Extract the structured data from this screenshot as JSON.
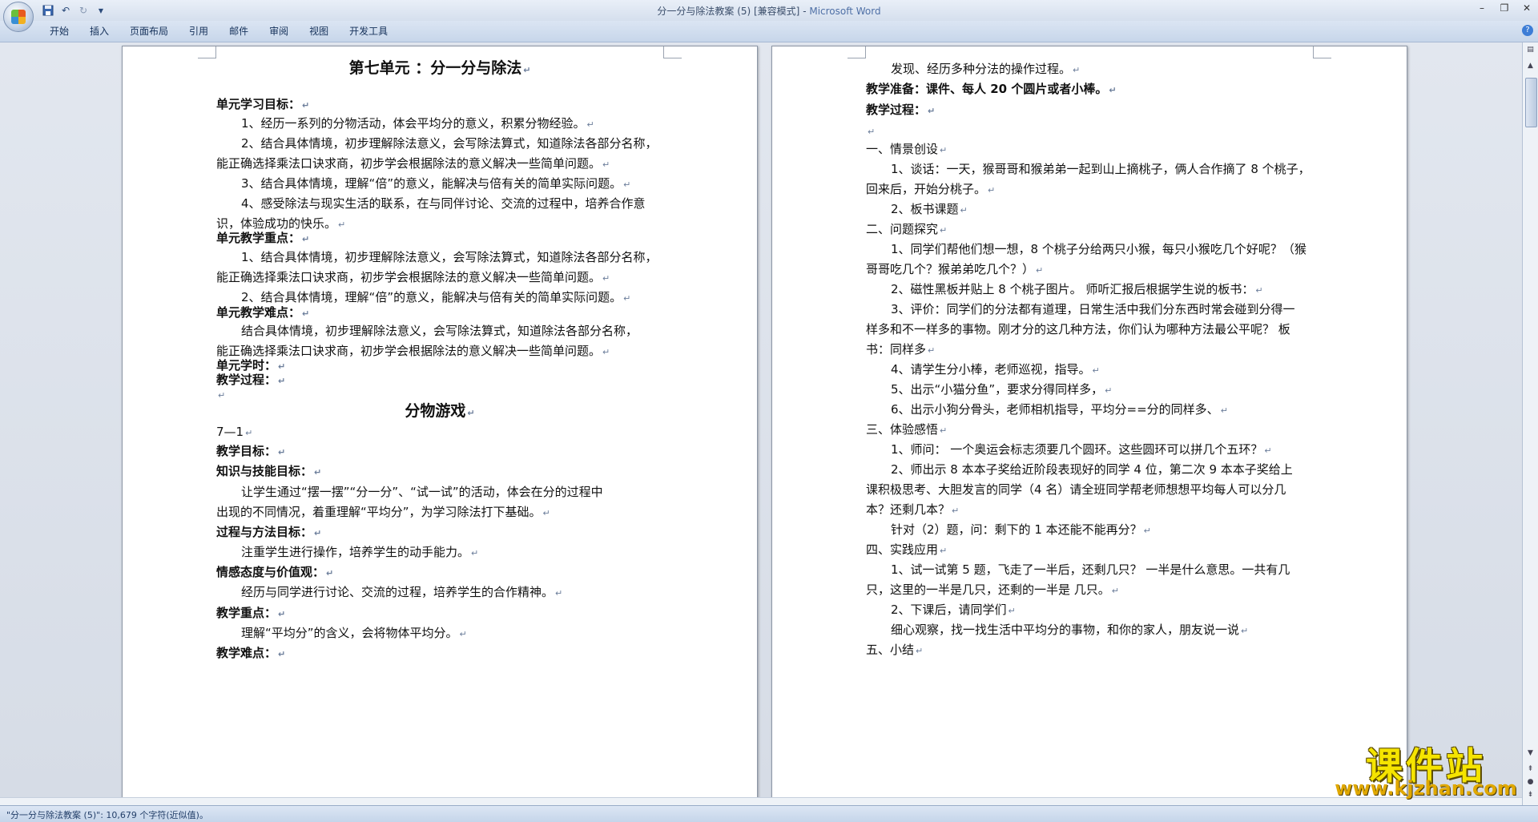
{
  "window": {
    "title_doc": "分一分与除法教案 (5) [兼容模式]",
    "title_sep": " - ",
    "title_app": "Microsoft Word"
  },
  "ribbon": {
    "tabs": [
      "开始",
      "插入",
      "页面布局",
      "引用",
      "邮件",
      "审阅",
      "视图",
      "开发工具"
    ]
  },
  "paragraph_mark": "↵",
  "pages": {
    "left": [
      {
        "text": "第七单元 ：分一分与除法",
        "style": "heading"
      },
      {
        "text": "单元学习目标：",
        "style": "bold"
      },
      {
        "text": "1、经历一系列的分物活动，体会平均分的意义，积累分物经验。",
        "style": "indent"
      },
      {
        "text": "2、结合具体情境，初步理解除法意义，会写除法算式，知道除法各部分名称，",
        "style": "indent",
        "nomark": true
      },
      {
        "text": "能正确选择乘法口诀求商，初步学会根据除法的意义解决一些简单问题。",
        "style": "plain"
      },
      {
        "text": "3、结合具体情境，理解“倍”的意义，能解决与倍有关的简单实际问题。",
        "style": "indent"
      },
      {
        "text": "4、感受除法与现实生活的联系，在与同伴讨论、交流的过程中，培养合作意",
        "style": "indent",
        "nomark": true
      },
      {
        "text": "识，体验成功的快乐。",
        "style": "plain"
      },
      {
        "text": "单元教学重点：",
        "style": "bold"
      },
      {
        "text": "1、结合具体情境，初步理解除法意义，会写除法算式，知道除法各部分名称，",
        "style": "indent",
        "nomark": true
      },
      {
        "text": "能正确选择乘法口诀求商，初步学会根据除法的意义解决一些简单问题。",
        "style": "plain"
      },
      {
        "text": "2、结合具体情境，理解“倍”的意义，能解决与倍有关的简单实际问题。",
        "style": "indent"
      },
      {
        "text": "单元教学难点：",
        "style": "bold"
      },
      {
        "text": "结合具体情境，初步理解除法意义，会写除法算式，知道除法各部分名称，",
        "style": "indent",
        "nomark": true
      },
      {
        "text": "能正确选择乘法口诀求商，初步学会根据除法的意义解决一些简单问题。",
        "style": "plain"
      },
      {
        "text": "单元学时：",
        "style": "bold"
      },
      {
        "text": "教学过程：",
        "style": "bold"
      },
      {
        "text": "",
        "style": "plain"
      },
      {
        "text": "分物游戏",
        "style": "heading"
      },
      {
        "text": "7—1",
        "style": "plain"
      },
      {
        "text": "教学目标：",
        "style": "bold"
      },
      {
        "text": "知识与技能目标：",
        "style": "bold"
      },
      {
        "text": "让学生通过“摆一摆”“分一分”、“试一试”的活动，体会在分的过程中",
        "style": "indent",
        "nomark": true
      },
      {
        "text": "出现的不同情况，着重理解“平均分”，为学习除法打下基础。",
        "style": "plain"
      },
      {
        "text": "过程与方法目标：",
        "style": "bold"
      },
      {
        "text": "注重学生进行操作，培养学生的动手能力。",
        "style": "indent"
      },
      {
        "text": "情感态度与价值观：",
        "style": "bold"
      },
      {
        "text": "经历与同学进行讨论、交流的过程，培养学生的合作精神。",
        "style": "indent"
      },
      {
        "text": "教学重点：",
        "style": "bold"
      },
      {
        "text": "理解“平均分”的含义，会将物体平均分。",
        "style": "indent"
      },
      {
        "text": "教学难点：",
        "style": "bold"
      }
    ],
    "right": [
      {
        "text": "发现、经历多种分法的操作过程。",
        "style": "indent"
      },
      {
        "text": "教学准备：课件、每人 20 个圆片或者小棒。",
        "style": "bold"
      },
      {
        "text": "教学过程：",
        "style": "bold"
      },
      {
        "text": "",
        "style": "plain"
      },
      {
        "text": "一、情景创设",
        "style": "plain"
      },
      {
        "text": "1、谈话：一天，猴哥哥和猴弟弟一起到山上摘桃子，俩人合作摘了 8 个桃子，",
        "style": "indent",
        "nomark": true
      },
      {
        "text": "回来后，开始分桃子。",
        "style": "plain"
      },
      {
        "text": "2、板书课题",
        "style": "indent"
      },
      {
        "text": "二、问题探究",
        "style": "plain"
      },
      {
        "text": "1、同学们帮他们想一想，8 个桃子分给两只小猴，每只小猴吃几个好呢？（猴",
        "style": "indent",
        "nomark": true
      },
      {
        "text": "哥哥吃几个？猴弟弟吃几个？）",
        "style": "plain"
      },
      {
        "text": "2、磁性黑板并贴上 8 个桃子图片。 师听汇报后根据学生说的板书：",
        "style": "indent"
      },
      {
        "text": "3、评价：同学们的分法都有道理，日常生活中我们分东西时常会碰到分得一",
        "style": "indent",
        "nomark": true
      },
      {
        "text": "样多和不一样多的事物。刚才分的这几种方法，你们认为哪种方法最公平呢？ 板",
        "style": "plain",
        "nomark": true
      },
      {
        "text": "书：同样多",
        "style": "plain"
      },
      {
        "text": "4、请学生分小棒，老师巡视，指导。",
        "style": "indent"
      },
      {
        "text": "5、出示“小猫分鱼”，要求分得同样多，",
        "style": "indent"
      },
      {
        "text": "6、出示小狗分骨头，老师相机指导，平均分==分的同样多、",
        "style": "indent"
      },
      {
        "text": "三、体验感悟",
        "style": "plain"
      },
      {
        "text": "1、师问： 一个奥运会标志须要几个圆环。这些圆环可以拼几个五环？",
        "style": "indent"
      },
      {
        "text": "2、师出示 8 本本子奖给近阶段表现好的同学 4 位，第二次 9 本本子奖给上",
        "style": "indent",
        "nomark": true
      },
      {
        "text": "课积极思考、大胆发言的同学（4 名）请全班同学帮老师想想平均每人可以分几",
        "style": "plain",
        "nomark": true
      },
      {
        "text": "本？还剩几本？",
        "style": "plain"
      },
      {
        "text": "针对（2）题，问：剩下的 1 本还能不能再分？",
        "style": "indent"
      },
      {
        "text": "四、实践应用",
        "style": "plain"
      },
      {
        "text": "1、试一试第 5 题，飞走了一半后，还剩几只？ 一半是什么意思。一共有几",
        "style": "indent",
        "nomark": true
      },
      {
        "text": "只，这里的一半是几只，还剩的一半是 几只。",
        "style": "plain"
      },
      {
        "text": "2、下课后，请同学们",
        "style": "indent"
      },
      {
        "text": "细心观察，找一找生活中平均分的事物，和你的家人，朋友说一说",
        "style": "indent"
      },
      {
        "text": "五、小结",
        "style": "plain"
      }
    ]
  },
  "statusbar": {
    "text": "\"分一分与除法教案 (5)\": 10,679 个字符(近似值)。"
  },
  "watermark": {
    "main": "课件站",
    "url": "www.kjzhan.com"
  },
  "colors": {
    "ribbon_bg": "#c7d6ea",
    "page_bg": "#ffffff",
    "workspace_bg": "#d6dce6",
    "watermark_yellow": "#f5e400"
  }
}
